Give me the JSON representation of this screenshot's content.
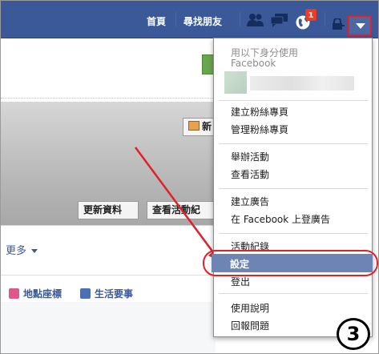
{
  "topbar": {
    "home_label": "首頁",
    "find_friends_label": "尋找朋友",
    "notification_count": "1",
    "bg_color": "#3b5998"
  },
  "page": {
    "new_button_partial": "新",
    "update_info_button": "更新資料",
    "activity_log_button": "查看活動紀",
    "more_tab": "更多",
    "places_label": "地點座標",
    "life_event_label": "生活要事"
  },
  "dropdown": {
    "use_as_label": "用以下身分使用",
    "facebook_label": "Facebook",
    "items": [
      {
        "label": "建立粉絲專頁"
      },
      {
        "label": "管理粉絲專頁"
      },
      {
        "label": "舉辦活動"
      },
      {
        "label": "查看活動"
      },
      {
        "label": "建立廣告"
      },
      {
        "label": "在 Facebook 上登廣告"
      },
      {
        "label": "活動紀錄"
      },
      {
        "label": "設定"
      },
      {
        "label": "登出"
      },
      {
        "label": "使用說明"
      },
      {
        "label": "回報問題"
      }
    ]
  },
  "annotation": {
    "step_number": "3",
    "highlight_color": "#e0202a"
  }
}
